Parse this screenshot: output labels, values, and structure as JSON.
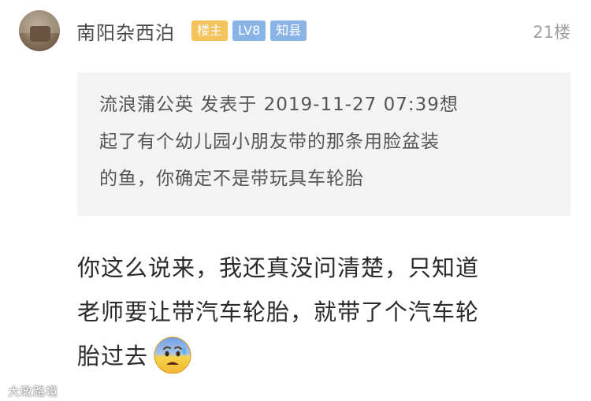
{
  "post": {
    "username": "南阳杂西泊",
    "badges": [
      "楼主",
      "LV8",
      "知县"
    ],
    "floor": "21楼"
  },
  "quote": {
    "lines": [
      "流浪蒲公英 发表于 2019-11-27 07:39想",
      "起了有个幼儿园小朋友带的那条用脸盆装",
      "的鱼，你确定不是带玩具车轮胎"
    ]
  },
  "reply": {
    "lines": [
      "你这么说来，我还真没问清楚，只知道",
      "老师要让带汽车轮胎，就带了个汽车轮",
      "胎过去"
    ],
    "emoji": "anxious-sweat-face-icon"
  },
  "watermark": "大政路境",
  "colors": {
    "owner_badge": "#f5c35c",
    "level_badge": "#8ab4e8",
    "quote_bg": "#f3f3f3"
  }
}
